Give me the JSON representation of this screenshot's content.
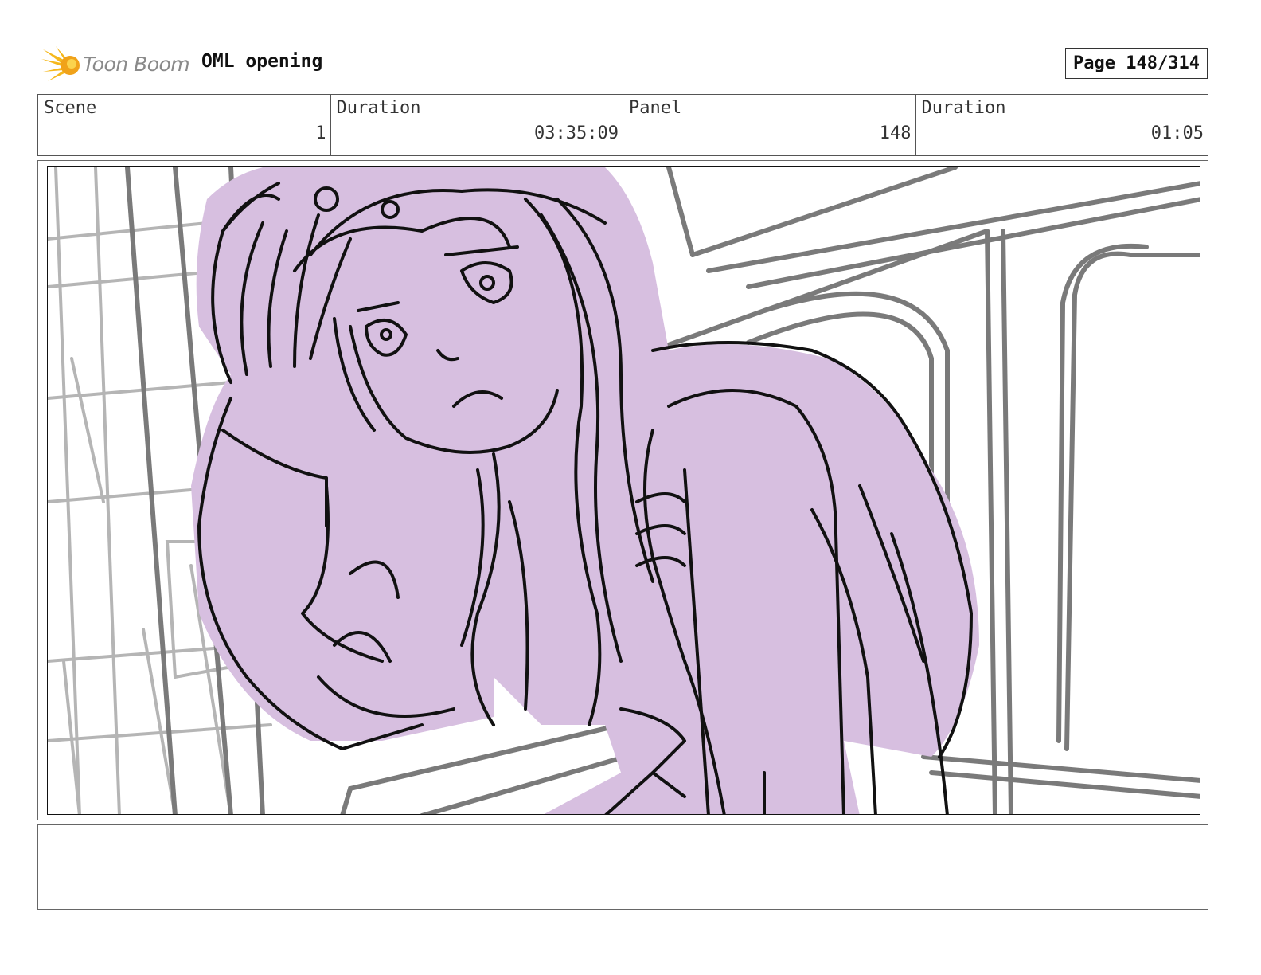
{
  "header": {
    "logo_text": "Toon Boom",
    "project_title": "OML opening",
    "page_label": "Page 148/314"
  },
  "info": {
    "scene_label": "Scene",
    "scene_value": "1",
    "scene_duration_label": "Duration",
    "scene_duration_value": "03:35:09",
    "panel_label": "Panel",
    "panel_value": "148",
    "panel_duration_label": "Duration",
    "panel_duration_value": "01:05"
  },
  "notes": {
    "text": ""
  },
  "colors": {
    "accent_fill": "#d7bfe0",
    "logo_orange": "#f5a623",
    "sketch_gray": "#9a9a9a",
    "ink": "#111111"
  }
}
